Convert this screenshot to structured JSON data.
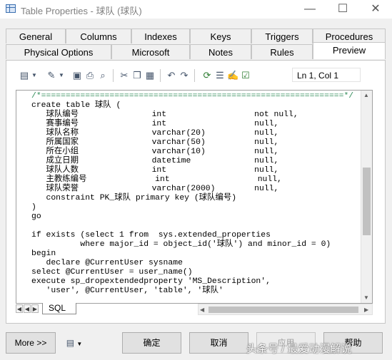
{
  "window": {
    "title": "Table Properties - 球队 (球队)",
    "minimize": "—",
    "maximize": "☐",
    "close": "✕"
  },
  "tabs_row1": [
    "General",
    "Columns",
    "Indexes",
    "Keys",
    "Triggers",
    "Procedures"
  ],
  "tabs_row2": [
    "Physical Options",
    "Microsoft",
    "Notes",
    "Rules",
    "Preview"
  ],
  "active_tab": "Preview",
  "toolbar": {
    "position": "Ln 1, Col 1"
  },
  "editor": {
    "lines": [
      "/*==============================================================*/",
      "create table 球队 (",
      "   球队编号               int                  not null,",
      "   赛事编号               int                  null,",
      "   球队名称               varchar(20)          null,",
      "   所属国家               varchar(50)          null,",
      "   所在小组               varchar(10)          null,",
      "   成立日期               datetime             null,",
      "   球队人数               int                  null,",
      "   主教练编号              int                  null,",
      "   球队荣誉               varchar(2000)        null,",
      "   constraint PK_球队 primary key (球队编号)",
      ")",
      "go",
      "",
      "if exists (select 1 from  sys.extended_properties",
      "          where major_id = object_id('球队') and minor_id = 0)",
      "begin",
      "   declare @CurrentUser sysname",
      "select @CurrentUser = user_name()",
      "execute sp_dropextendedproperty 'MS_Description',",
      "   'user', @CurrentUser, 'table', '球队'"
    ],
    "sheet_tab": "SQL"
  },
  "buttons": {
    "more": "More >>",
    "ok": "确定",
    "cancel": "取消",
    "apply": "应用",
    "help": "帮助"
  },
  "watermark": "头条号 / 最爱动漫解说"
}
